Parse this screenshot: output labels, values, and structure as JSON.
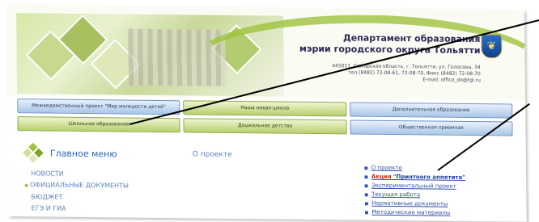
{
  "header": {
    "title_line1": "Департамент образования",
    "title_line2": "мэрии городского округа Тольятти",
    "address_line1": "445011, Самарская область, г. Тольятти, ул. Голосова, 34",
    "address_line2": "тел.(8482) 72-08-61, 72-08-70, Факс (8482) 72-08-70",
    "address_line3": "E-mail: office_do@tgl.ru"
  },
  "nav": {
    "row1": [
      "Межведомственный проект \"Мир молодости детей\"",
      "Наша новая школа",
      "Дополнительное образование"
    ],
    "row2": [
      "Школьное образование",
      "Дошкольное детство",
      "Общественная приемная"
    ]
  },
  "main_menu": {
    "title": "Главное меню",
    "items": [
      "НОВОСТИ",
      "ОФИЦИАЛЬНЫЕ ДОКУМЕНТЫ",
      "БЮДЖЕТ",
      "ЕГЭ И ГИА"
    ]
  },
  "content": {
    "about_link": "О проекте",
    "links": {
      "item1": "О проекте",
      "item2_prefix": "Акция",
      "item2_link": "\"Приятного аппетита\"",
      "item3": "Экспериментальный проект",
      "item4": "Текущая работа",
      "item5": "Нормативные документы",
      "item6": "Методические материалы"
    }
  },
  "colors": {
    "accent_green": "#9ec33c",
    "link_blue": "#5b7fc2",
    "highlight_red": "#d2241b"
  }
}
